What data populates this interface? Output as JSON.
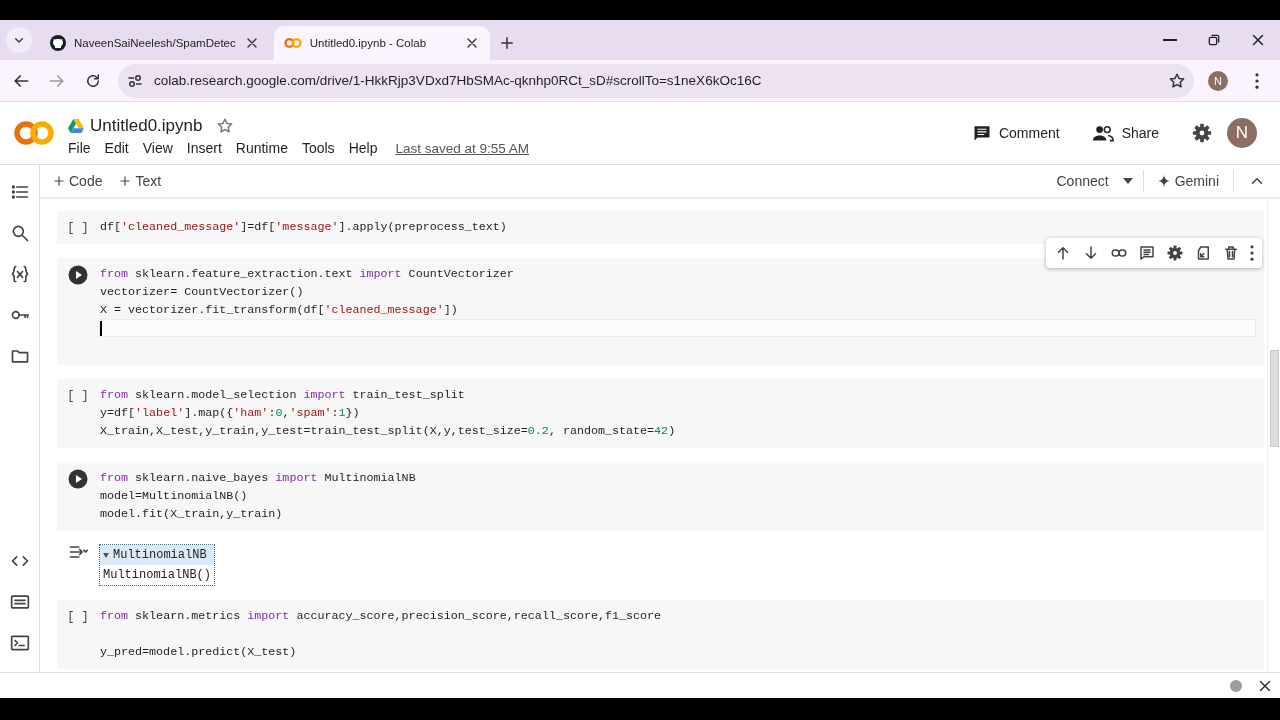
{
  "browser": {
    "tabs": [
      {
        "title": "NaveenSaiNeelesh/SpamDetec",
        "selected": false
      },
      {
        "title": "Untitled0.ipynb - Colab",
        "selected": true
      }
    ],
    "url": "colab.research.google.com/drive/1-HkkRjp3VDxd7HbSMAc-qknhp0RCt_sD#scrollTo=s1neX6kOc16C",
    "profile_initial": "N"
  },
  "notebook": {
    "title": "Untitled0.ipynb",
    "starred": false,
    "menus": [
      "File",
      "Edit",
      "View",
      "Insert",
      "Runtime",
      "Tools",
      "Help"
    ],
    "last_saved": "Last saved at 9:55 AM",
    "actions": [
      {
        "kind": "comment",
        "label": "Comment"
      },
      {
        "kind": "share",
        "label": "Share"
      }
    ],
    "avatar_initial": "N"
  },
  "toolbar": {
    "insert": [
      "Code",
      "Text"
    ],
    "connect": "Connect",
    "gemini": "Gemini"
  },
  "cells": [
    {
      "gutter": {
        "kind": "prompt",
        "text": "[ ]"
      },
      "focused": false,
      "lines": [
        {
          "tokens": [
            {
              "text": "df[",
              "kind": "plain"
            },
            {
              "text": "'cleaned_message'",
              "kind": "string"
            },
            {
              "text": "]=df[",
              "kind": "plain"
            },
            {
              "text": "'message'",
              "kind": "string"
            },
            {
              "text": "].apply(preprocess_text)",
              "kind": "plain"
            }
          ]
        }
      ]
    },
    {
      "gutter": {
        "kind": "run"
      },
      "focused": true,
      "lines": [
        {
          "tokens": [
            {
              "text": "from",
              "kind": "keyword"
            },
            {
              "text": " sklearn.feature_extraction.text ",
              "kind": "plain"
            },
            {
              "text": "import",
              "kind": "keyword"
            },
            {
              "text": " CountVectorizer",
              "kind": "plain"
            }
          ]
        },
        {
          "tokens": [
            {
              "text": "vectorizer= CountVectorizer()",
              "kind": "plain"
            }
          ]
        },
        {
          "tokens": [
            {
              "text": "X = vectorizer.fit_transform(df[",
              "kind": "plain"
            },
            {
              "text": "'cleaned_message'",
              "kind": "string"
            },
            {
              "text": "])",
              "kind": "plain"
            }
          ]
        }
      ]
    },
    {
      "gutter": {
        "kind": "prompt",
        "text": "[ ]"
      },
      "focused": false,
      "lines": [
        {
          "tokens": [
            {
              "text": "from",
              "kind": "keyword"
            },
            {
              "text": " sklearn.model_selection ",
              "kind": "plain"
            },
            {
              "text": "import",
              "kind": "keyword"
            },
            {
              "text": " train_test_split",
              "kind": "plain"
            }
          ]
        },
        {
          "tokens": [
            {
              "text": "y=df[",
              "kind": "plain"
            },
            {
              "text": "'label'",
              "kind": "string"
            },
            {
              "text": "].map({",
              "kind": "plain"
            },
            {
              "text": "'ham'",
              "kind": "string"
            },
            {
              "text": ":",
              "kind": "plain"
            },
            {
              "text": "0",
              "kind": "number"
            },
            {
              "text": ",",
              "kind": "plain"
            },
            {
              "text": "'spam'",
              "kind": "string"
            },
            {
              "text": ":",
              "kind": "plain"
            },
            {
              "text": "1",
              "kind": "number"
            },
            {
              "text": "})",
              "kind": "plain"
            }
          ]
        },
        {
          "tokens": [
            {
              "text": "X_train,X_test,y_train,y_test=train_test_split(X,y,test_size=",
              "kind": "plain"
            },
            {
              "text": "0.2",
              "kind": "number"
            },
            {
              "text": ", random_state=",
              "kind": "plain"
            },
            {
              "text": "42",
              "kind": "number"
            },
            {
              "text": ")",
              "kind": "plain"
            }
          ]
        }
      ]
    },
    {
      "gutter": {
        "kind": "run"
      },
      "focused": false,
      "lines": [
        {
          "tokens": [
            {
              "text": "from",
              "kind": "keyword"
            },
            {
              "text": " sklearn.naive_bayes ",
              "kind": "plain"
            },
            {
              "text": "import",
              "kind": "keyword"
            },
            {
              "text": " MultinomialNB",
              "kind": "plain"
            }
          ]
        },
        {
          "tokens": [
            {
              "text": "model=MultinomialNB()",
              "kind": "plain"
            }
          ]
        },
        {
          "tokens": [
            {
              "text": "model.fit(X_train,y_train)",
              "kind": "plain"
            }
          ]
        }
      ],
      "output": {
        "estimator": "MultinomialNB",
        "repr": "MultinomialNB()"
      }
    },
    {
      "gutter": {
        "kind": "prompt",
        "text": "[ ]"
      },
      "focused": false,
      "lines": [
        {
          "tokens": [
            {
              "text": "from",
              "kind": "keyword"
            },
            {
              "text": " sklearn.metrics ",
              "kind": "plain"
            },
            {
              "text": "import",
              "kind": "keyword"
            },
            {
              "text": " accuracy_score,precision_score,recall_score,f1_score",
              "kind": "plain"
            }
          ]
        },
        {
          "blank": true
        },
        {
          "tokens": [
            {
              "text": "y_pred=model.predict(X_test)",
              "kind": "plain"
            }
          ]
        }
      ]
    }
  ]
}
